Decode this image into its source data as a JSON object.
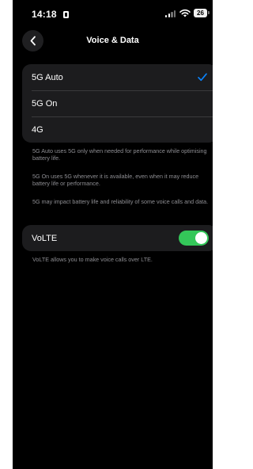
{
  "status_bar": {
    "time": "14:18",
    "battery": "26"
  },
  "nav": {
    "title": "Voice & Data"
  },
  "network_options": [
    {
      "label": "5G Auto",
      "selected": true
    },
    {
      "label": "5G On",
      "selected": false
    },
    {
      "label": "4G",
      "selected": false
    }
  ],
  "notes": [
    "5G Auto uses 5G only when needed for performance while optimising battery life.",
    "5G On uses 5G whenever it is available, even when it may reduce battery life or performance.",
    "5G may impact battery life and reliability of some voice calls and data."
  ],
  "volte": {
    "label": "VoLTE",
    "enabled": true,
    "footnote": "VoLTE allows you to make voice calls over LTE."
  },
  "colors": {
    "accent": "#0a84ff",
    "toggle_on": "#34c759",
    "cell_bg": "#1c1c1e",
    "secondary_text": "#8e8e93"
  }
}
